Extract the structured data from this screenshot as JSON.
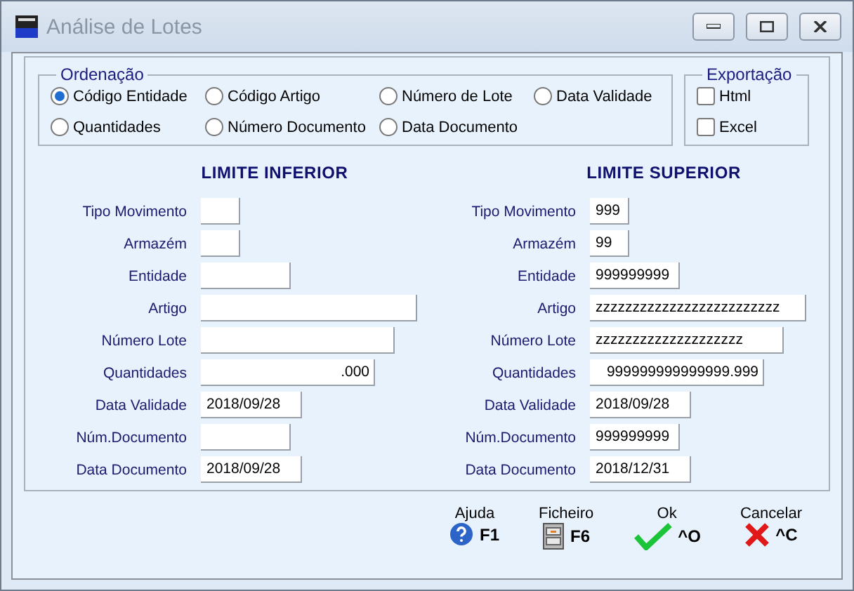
{
  "window": {
    "title": "Análise de Lotes"
  },
  "ordering": {
    "title": "Ordenação",
    "options": [
      {
        "label": "Código Entidade",
        "selected": true
      },
      {
        "label": "Código Artigo",
        "selected": false
      },
      {
        "label": "Número de Lote",
        "selected": false
      },
      {
        "label": "Data Validade",
        "selected": false
      },
      {
        "label": "Quantidades",
        "selected": false
      },
      {
        "label": "Número Documento",
        "selected": false
      },
      {
        "label": "Data Documento",
        "selected": false
      }
    ]
  },
  "export": {
    "title": "Exportação",
    "options": [
      {
        "label": "Html",
        "checked": false
      },
      {
        "label": "Excel",
        "checked": false
      }
    ]
  },
  "limits": [
    {
      "title": "LIMITE INFERIOR",
      "fields": [
        {
          "label": "Tipo Movimento"
        },
        {
          "label": "Armazém"
        },
        {
          "label": "Entidade"
        },
        {
          "label": "Artigo"
        },
        {
          "label": "Número Lote"
        },
        {
          "label": "Quantidades",
          "value": ".000"
        },
        {
          "label": "Data Validade",
          "value": "2018/09/28"
        },
        {
          "label": "Núm.Documento"
        },
        {
          "label": "Data Documento",
          "value": "2018/09/28"
        }
      ]
    },
    {
      "title": "LIMITE SUPERIOR",
      "fields": [
        {
          "label": "Tipo Movimento",
          "value": "999"
        },
        {
          "label": "Armazém",
          "value": "99"
        },
        {
          "label": "Entidade",
          "value": "999999999"
        },
        {
          "label": "Artigo",
          "value": "zzzzzzzzzzzzzzzzzzzzzzzzz"
        },
        {
          "label": "Número Lote",
          "value": "zzzzzzzzzzzzzzzzzzzz"
        },
        {
          "label": "Quantidades",
          "value": "999999999999999.999"
        },
        {
          "label": "Data Validade",
          "value": "2018/09/28"
        },
        {
          "label": "Núm.Documento",
          "value": "999999999"
        },
        {
          "label": "Data Documento",
          "value": "2018/12/31"
        }
      ]
    }
  ],
  "actions": [
    {
      "kind": "help",
      "label": "Ajuda",
      "key": "F1"
    },
    {
      "kind": "file",
      "label": "Ficheiro",
      "key": "F6"
    },
    {
      "kind": "ok",
      "label": "Ok",
      "key": "^O"
    },
    {
      "kind": "cancel",
      "label": "Cancelar",
      "key": "^C"
    }
  ]
}
